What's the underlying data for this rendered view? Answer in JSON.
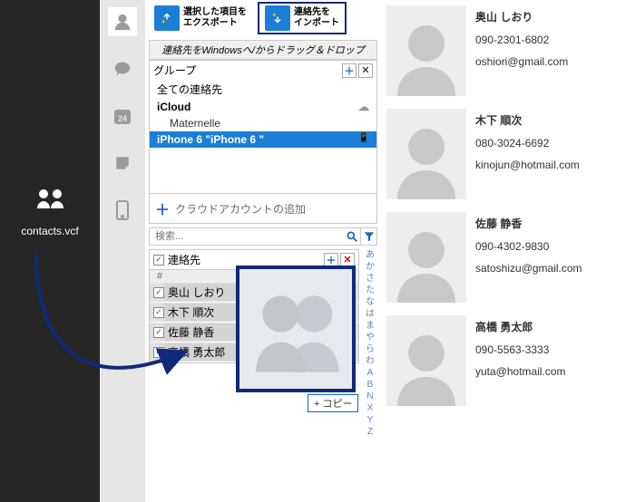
{
  "desktop": {
    "file_label": "contacts.vcf"
  },
  "toolbar": {
    "export_label": "選択した項目を\nエクスポート",
    "import_label": "連絡先を\nインポート"
  },
  "banner": "連絡先をWindowsへ/からドラッグ＆ドロップ",
  "groups": {
    "header": "グループ",
    "all_contacts": "全ての連絡先",
    "icloud": "iCloud",
    "maternelle": "Maternelle",
    "selected": "iPhone 6 \"iPhone 6 \"",
    "add_account": "クラウドアカウントの追加"
  },
  "search": {
    "placeholder": "検索..."
  },
  "contacts": {
    "header": "連絡先",
    "hash": "#",
    "rows": [
      {
        "name": "奥山 しおり"
      },
      {
        "name": "木下 順次"
      },
      {
        "name": "佐藤 静香"
      },
      {
        "name": "高橋 勇太郎"
      }
    ],
    "copy_tip": "+ コピー"
  },
  "index_chars": [
    "あ",
    "か",
    "さ",
    "た",
    "な",
    "は",
    "ま",
    "や",
    "ら",
    "わ",
    "A",
    "B",
    "N",
    "X",
    "Y",
    "Z"
  ],
  "cards": [
    {
      "name": "奥山 しおり",
      "phone": "090-2301-6802",
      "email": "oshiori@gmail.com"
    },
    {
      "name": "木下 順次",
      "phone": "080-3024-6692",
      "email": "kinojun@hotmail.com"
    },
    {
      "name": "佐藤 静香",
      "phone": "090-4302-9830",
      "email": "satoshizu@gmail.com"
    },
    {
      "name": "高橋 勇太郎",
      "phone": "090-5563-3333",
      "email": "yuta@hotmail.com"
    }
  ]
}
